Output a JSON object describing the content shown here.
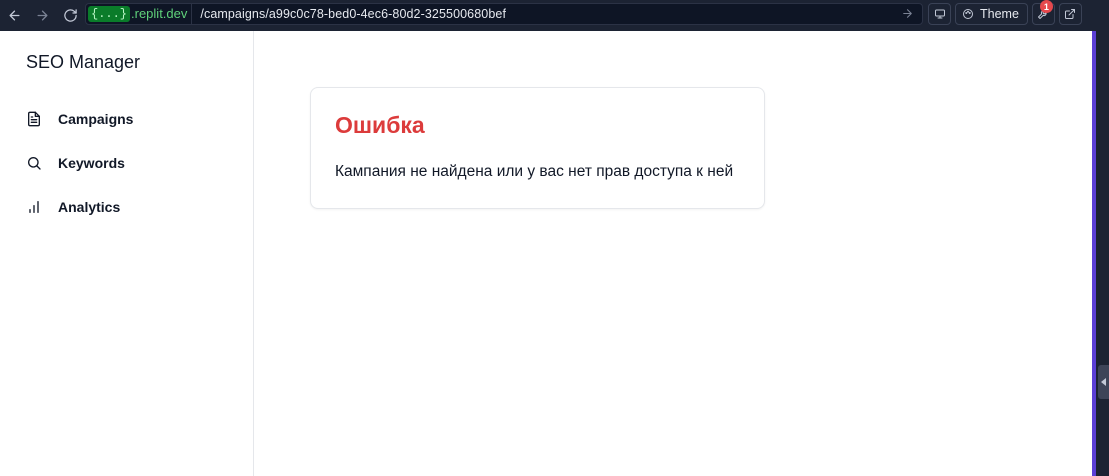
{
  "browser": {
    "domain_badge": "{...}",
    "domain": ".replit.dev",
    "url_path": "/campaigns/a99c0c78-bed0-4ec6-80d2-325500680bef",
    "theme_label": "Theme",
    "notification_count": "1"
  },
  "sidebar": {
    "app_title": "SEO Manager",
    "items": [
      {
        "label": "Campaigns",
        "icon": "file-text-icon"
      },
      {
        "label": "Keywords",
        "icon": "search-icon"
      },
      {
        "label": "Analytics",
        "icon": "bar-chart-icon"
      }
    ]
  },
  "main": {
    "error_title": "Ошибка",
    "error_message": "Кампания не найдена или у вас нет прав доступа к ней"
  },
  "colors": {
    "error": "#dc3b3b",
    "browser_bg": "#1c2333",
    "accent_strip": "#5b3fd6"
  }
}
